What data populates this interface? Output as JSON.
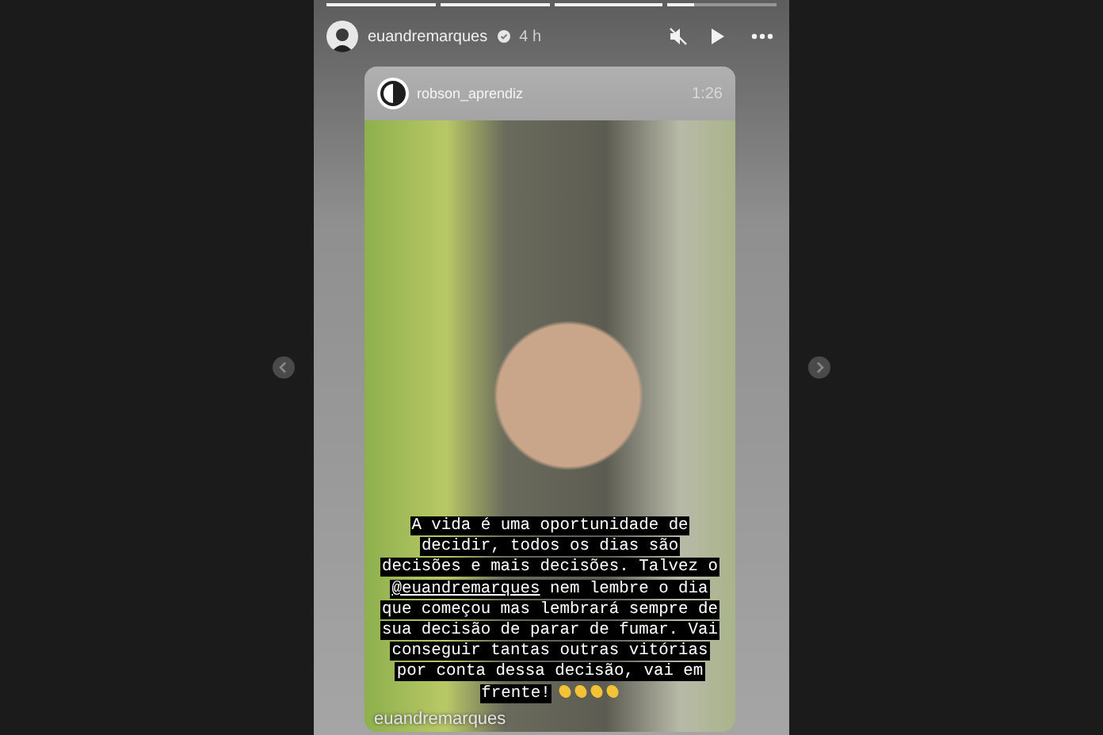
{
  "progress": [
    {
      "level": 1
    },
    {
      "level": 1
    },
    {
      "level": 1
    },
    {
      "level": 0.25
    }
  ],
  "story_header": {
    "username": "euandremarques",
    "verified": true,
    "time": "4 h",
    "muted": true
  },
  "shared_post": {
    "username": "robson_aprendiz",
    "duration": "1:26"
  },
  "caption": {
    "text_before": "A vida é uma oportunidade de decidir, todos os dias são decisões e mais decisões. Talvez o",
    "mention": "@euandremarques",
    "text_after": "nem lembre o dia que começou mas lembrará sempre de sua decisão de parar de fumar. Vai conseguir tantas outras vitórias por conta dessa decisão, vai em frente!"
  },
  "mention_tag": "euandremarques"
}
